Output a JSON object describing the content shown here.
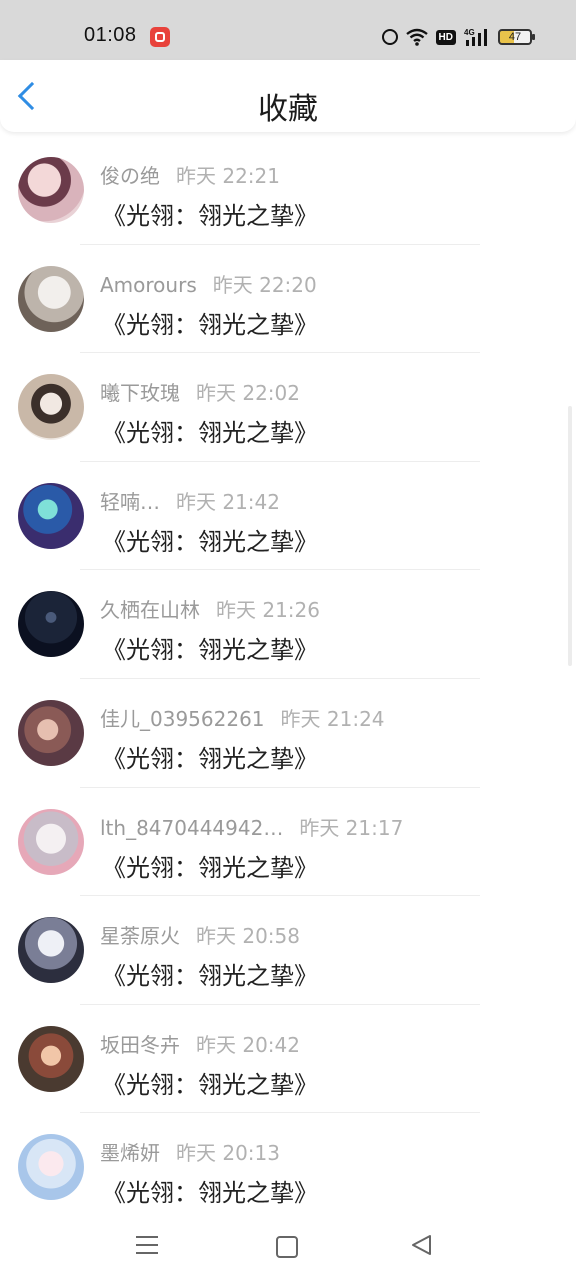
{
  "status_bar": {
    "time": "01:08",
    "battery": "47",
    "network": "4G",
    "hd": "HD",
    "icons": [
      "app-notification-icon",
      "alarm-icon",
      "wifi-icon",
      "hd-icon",
      "signal-icon",
      "battery-icon"
    ]
  },
  "header": {
    "title": "收藏",
    "back_icon": "chevron-left-icon",
    "accent": "#2f8de4"
  },
  "favorites": [
    {
      "user": "俊の绝",
      "time": "昨天 22:21",
      "title": "《光翎：翎光之挚》"
    },
    {
      "user": "Amorours",
      "time": "昨天 22:20",
      "title": "《光翎：翎光之挚》"
    },
    {
      "user": "曦下玫瑰",
      "time": "昨天 22:02",
      "title": "《光翎：翎光之挚》"
    },
    {
      "user": "轻喃…",
      "time": "昨天 21:42",
      "title": "《光翎：翎光之挚》"
    },
    {
      "user": "久栖在山林",
      "time": "昨天 21:26",
      "title": "《光翎：翎光之挚》"
    },
    {
      "user": "佳儿_039562261",
      "time": "昨天 21:24",
      "title": "《光翎：翎光之挚》"
    },
    {
      "user": "lth_8470444942…",
      "time": "昨天 21:17",
      "title": "《光翎：翎光之挚》"
    },
    {
      "user": "星荼原火",
      "time": "昨天 20:58",
      "title": "《光翎：翎光之挚》"
    },
    {
      "user": "坂田冬卉",
      "time": "昨天 20:42",
      "title": "《光翎：翎光之挚》"
    },
    {
      "user": "墨烯妍",
      "time": "昨天 20:13",
      "title": "《光翎：翎光之挚》"
    }
  ],
  "nav_bar": {
    "icons": [
      "menu-icon",
      "home-icon",
      "back-triangle-icon"
    ]
  }
}
